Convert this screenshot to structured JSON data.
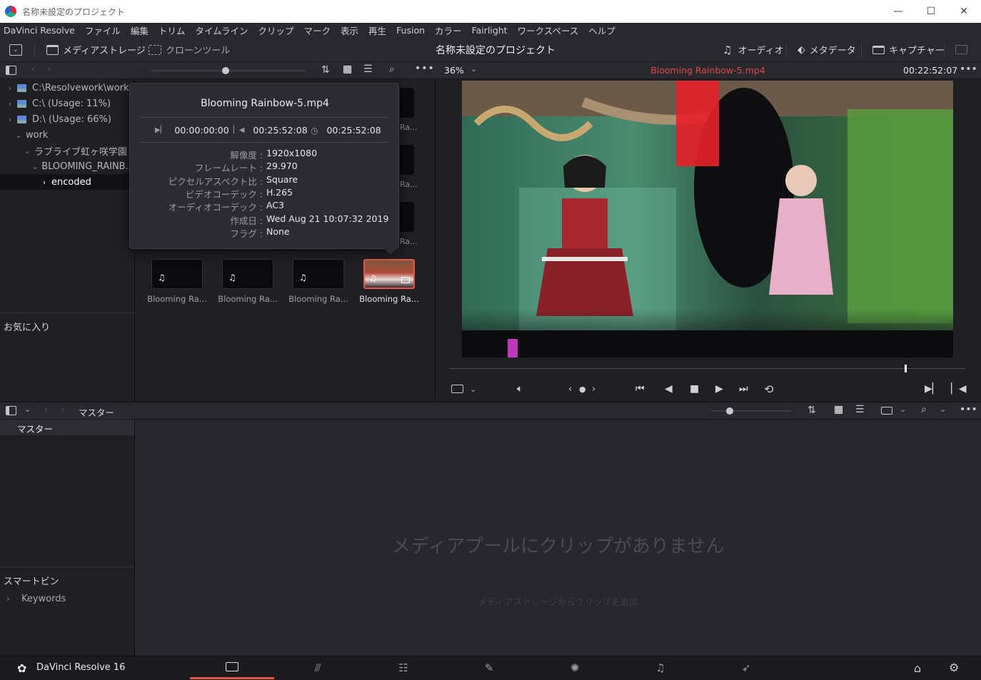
{
  "window": {
    "title": "名称未設定のプロジェクト",
    "controls": [
      "—",
      "☐",
      "✕"
    ]
  },
  "menu": [
    "DaVinci Resolve",
    "ファイル",
    "編集",
    "トリム",
    "タイムライン",
    "クリップ",
    "マーク",
    "表示",
    "再生",
    "Fusion",
    "カラー",
    "Fairlight",
    "ワークスペース",
    "ヘルプ"
  ],
  "toolbar": {
    "media_storage": "メディアストレージ",
    "clone_tool": "クローンツール",
    "project_title": "名称未設定のプロジェクト",
    "audio": "オーディオ",
    "metadata": "メタデータ",
    "capture": "キャプチャー"
  },
  "storage_tree": [
    {
      "label": "C:\\Resolvework\\work",
      "chev": "›",
      "drive": true
    },
    {
      "label": "C:\\ (Usage: 11%)",
      "chev": "›",
      "drive": true
    },
    {
      "label": "D:\\ (Usage: 66%)",
      "chev": "›",
      "drive": true
    },
    {
      "label": "work",
      "chev": "⌄",
      "drive": false
    },
    {
      "label": "ラブライブ虹ヶ咲学園",
      "chev": "⌄",
      "drive": false
    },
    {
      "label": "BLOOMING_RAINB...",
      "chev": "⌄",
      "drive": false
    },
    {
      "label": "encoded",
      "chev": "›",
      "drive": false
    }
  ],
  "favorites_label": "お気に入り",
  "clips": [
    {
      "label": "Blooming Ra...",
      "note": "♫"
    },
    {
      "label": "Blooming Ra...",
      "note": "♫"
    },
    {
      "label": "Blooming Ra...",
      "note": "♫"
    },
    {
      "label": "Blooming Ra...",
      "note": "♫"
    }
  ],
  "partial_labels": [
    "Ra...",
    "Ra...",
    "Ra..."
  ],
  "popup": {
    "title": "Blooming Rainbow-5.mp4",
    "tc_start": "00:00:00:00",
    "tc_end": "00:25:52:08",
    "tc_duration": "00:25:52:08",
    "details": [
      {
        "k": "解像度 :",
        "v": "1920x1080"
      },
      {
        "k": "フレームレート :",
        "v": "29.970"
      },
      {
        "k": "ピクセルアスペクト比 :",
        "v": "Square"
      },
      {
        "k": "ビデオコーデック :",
        "v": "H.265"
      },
      {
        "k": "オーディオコーデック :",
        "v": "AC3"
      },
      {
        "k": "作成日 :",
        "v": "Wed Aug 21 10:07:32 2019"
      },
      {
        "k": "フラグ :",
        "v": "None"
      }
    ]
  },
  "viewer": {
    "zoom": "36%",
    "clip_name": "Blooming Rainbow-5.mp4",
    "timecode": "00:22:52:07",
    "playhead_fraction": 0.884
  },
  "bottom": {
    "breadcrumb": "マスター",
    "bin_master": "マスター",
    "empty_message": "メディアプールにクリップがありません",
    "empty_sub": "メディアストレージからクリップを追加",
    "smart_bins": "スマートビン",
    "keywords": "Keywords"
  },
  "app_name": "DaVinci Resolve 16",
  "colors": {
    "accent_red": "#e8564a",
    "clip_name_red": "#e04848"
  }
}
